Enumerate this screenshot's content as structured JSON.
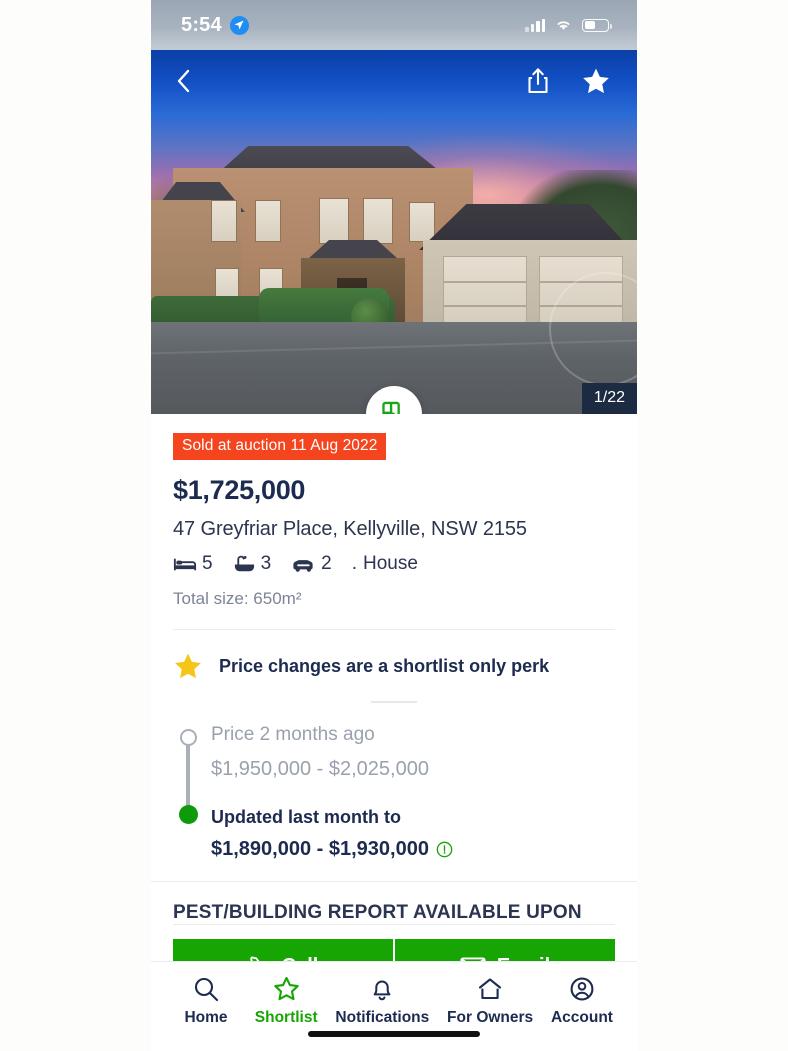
{
  "status_bar": {
    "time": "5:54",
    "location_icon": "location-arrow-icon",
    "signal_icon": "cellular-signal-icon",
    "wifi_icon": "wifi-icon",
    "battery_icon": "battery-icon"
  },
  "hero": {
    "back_icon": "chevron-left-icon",
    "share_icon": "share-icon",
    "favourite_icon": "star-filled-icon",
    "floorplan_icon": "floorplan-icon",
    "photo_counter": "1/22"
  },
  "listing": {
    "status_badge": "Sold at auction 11 Aug 2022",
    "price": "$1,725,000",
    "address": "47 Greyfriar Place, Kellyville, NSW 2155",
    "features": [
      {
        "icon": "bed-icon",
        "value": "5"
      },
      {
        "icon": "bath-icon",
        "value": "3"
      },
      {
        "icon": "car-icon",
        "value": "2"
      }
    ],
    "separator": ".",
    "property_type": "House",
    "total_size": "Total size: 650m²"
  },
  "perk": {
    "icon": "star-filled-icon",
    "text": "Price changes are a shortlist only perk"
  },
  "price_history": {
    "previous": {
      "label": "Price 2 months ago",
      "value": "$1,950,000 - $2,025,000"
    },
    "current": {
      "label": "Updated last month to",
      "value": "$1,890,000 - $1,930,000",
      "info_icon": "info-circle-icon"
    }
  },
  "report": {
    "heading": "PEST/BUILDING REPORT AVAILABLE UPON"
  },
  "cta": {
    "call_label": "Call",
    "call_icon": "phone-icon",
    "email_label": "Email",
    "email_icon": "envelope-icon"
  },
  "tabbar": {
    "items": [
      {
        "label": "Home",
        "icon": "search-icon",
        "active": false
      },
      {
        "label": "Shortlist",
        "icon": "star-outline-icon",
        "active": true
      },
      {
        "label": "Notifications",
        "icon": "bell-icon",
        "active": false
      },
      {
        "label": "For Owners",
        "icon": "house-icon",
        "active": false
      },
      {
        "label": "Account",
        "icon": "person-circle-icon",
        "active": false
      }
    ]
  },
  "colors": {
    "brand_green": "#17A503",
    "sold_red": "#F4451F",
    "navy_text": "#1D2B50",
    "muted_text": "#9AA1AD",
    "timeline_green": "#0D9B0D",
    "star_gold": "#F5C518"
  }
}
